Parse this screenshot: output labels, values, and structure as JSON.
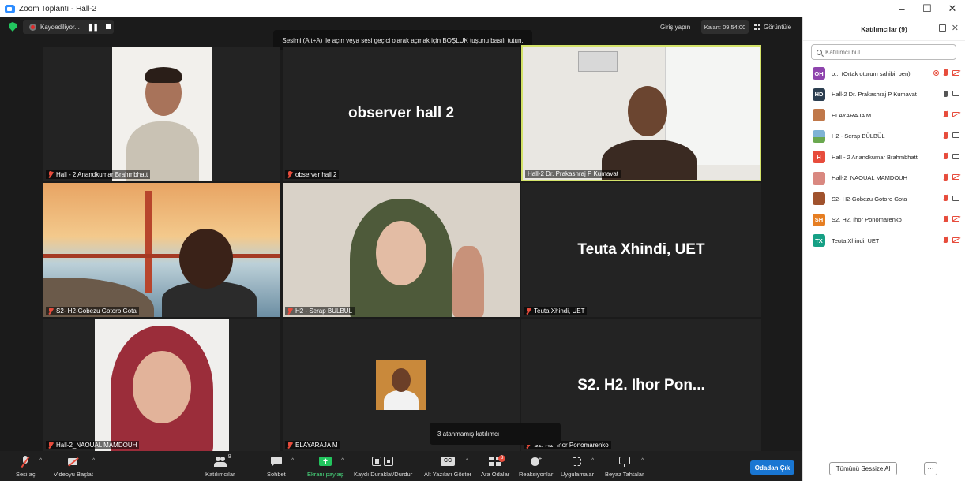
{
  "window": {
    "title": "Zoom Toplantı - Hall-2",
    "minimize": "–",
    "maximize": "☐",
    "close": "✕"
  },
  "topbar": {
    "recording_label": "Kaydediliyor...",
    "tooltip": "Sesimi (Alt+A) ile açın veya sesi geçici olarak açmak için BOŞLUK tuşunu basılı tutun.",
    "signin": "Giriş yapın",
    "timer": "Kalan: 09:54:00",
    "view": "Görüntüle"
  },
  "tiles": [
    {
      "name": "Hall - 2 Anandkumar Brahmbhatt",
      "video": true
    },
    {
      "name": "observer hall 2",
      "bigname": "observer hall 2",
      "video": false
    },
    {
      "name": "Hall-2 Dr. Prakashraj P Kumavat",
      "video": true,
      "active": true
    },
    {
      "name": "S2- H2-Gobezu Gotoro Gota",
      "video": true
    },
    {
      "name": "H2 - Serap BÜLBÜL",
      "video": true
    },
    {
      "name": "Teuta Xhindi, UET",
      "bigname": "Teuta Xhindi, UET",
      "video": false
    },
    {
      "name": "Hall-2_NAOUAL MAMDOUH",
      "video": true
    },
    {
      "name": "ELAYARAJA M",
      "video": false
    },
    {
      "name": "S2. H2. Ihor Ponomarenko",
      "bigname": "S2. H2. Ihor Pon...",
      "video": false
    }
  ],
  "popup": {
    "unassigned": "3 atanmamış katılımcı"
  },
  "toolbar": {
    "audio": "Sesi aç",
    "video": "Videoyu Başlat",
    "participants": "Katılımcılar",
    "participants_count": "9",
    "chat": "Sohbet",
    "share": "Ekranı paylaş",
    "record": "Kaydı Duraklat/Durdur",
    "captions": "Alt Yazıları Göster",
    "captions_icon": "CC",
    "breakout": "Ara Odalar",
    "breakout_badge": "3",
    "reactions": "Reaksiyonlar",
    "apps": "Uygulamalar",
    "whiteboard": "Beyaz Tahtalar",
    "leave": "Odadan Çık"
  },
  "panel": {
    "title": "Katılımcılar (9)",
    "search_placeholder": "Katılımcı bul",
    "mute_all": "Tümünü Sessize Al",
    "more": "···",
    "participants": [
      {
        "initials": "OH",
        "color": "#8e44ad",
        "name": "o... (Ortak oturum sahibi, ben)",
        "mic": "off",
        "cam": "off",
        "rec": true
      },
      {
        "initials": "HD",
        "color": "#2c3e50",
        "name": "Hall-2 Dr. Prakashraj P Kumavat",
        "mic": "on",
        "cam": "on"
      },
      {
        "initials": "",
        "color": "#c0784a",
        "name": "ELAYARAJA M",
        "mic": "off",
        "cam": "off"
      },
      {
        "initials": "",
        "color": "#7fb3d5",
        "name": "H2 - Serap BÜLBÜL",
        "mic": "off",
        "cam": "on"
      },
      {
        "initials": "H",
        "color": "#e74c3c",
        "name": "Hall - 2 Anandkumar Brahmbhatt",
        "mic": "off",
        "cam": "on"
      },
      {
        "initials": "",
        "color": "#d98880",
        "name": "Hall-2_NAOUAL MAMDOUH",
        "mic": "off",
        "cam": "off"
      },
      {
        "initials": "",
        "color": "#a0522d",
        "name": "S2- H2-Gobezu Gotoro Gota",
        "mic": "off",
        "cam": "on"
      },
      {
        "initials": "SH",
        "color": "#e67e22",
        "name": "S2. H2. Ihor Ponomarenko",
        "mic": "off",
        "cam": "off"
      },
      {
        "initials": "TX",
        "color": "#16a085",
        "name": "Teuta Xhindi, UET",
        "mic": "off",
        "cam": "off"
      }
    ]
  }
}
